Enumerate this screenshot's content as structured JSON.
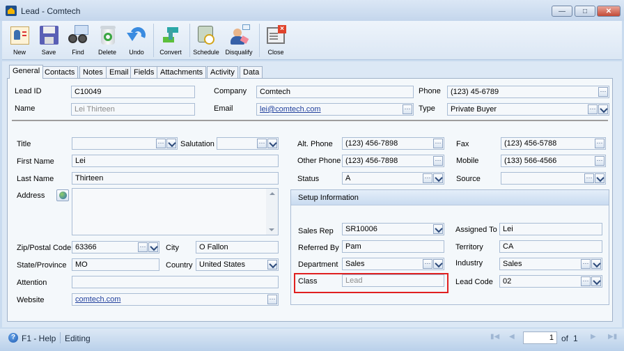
{
  "window": {
    "title": "Lead - Comtech",
    "controls": [
      "minimize",
      "maximize",
      "close"
    ]
  },
  "toolbar": {
    "items": [
      {
        "label": "New",
        "icon": "new-lead-icon"
      },
      {
        "label": "Save",
        "icon": "floppy-disk-icon"
      },
      {
        "label": "Find",
        "icon": "binoculars-icon"
      },
      {
        "label": "Delete",
        "icon": "recycle-bin-icon"
      },
      {
        "label": "Undo",
        "icon": "undo-arrow-icon"
      },
      {
        "label": "Convert",
        "icon": "convert-arrows-icon"
      },
      {
        "label": "Schedule",
        "icon": "schedule-clock-icon"
      },
      {
        "label": "Disqualify",
        "icon": "disqualify-person-icon"
      },
      {
        "label": "Close",
        "icon": "close-window-icon"
      }
    ]
  },
  "tabs": [
    "General",
    "Contacts",
    "Notes",
    "Email",
    "Fields",
    "Attachments",
    "Activity",
    "Data"
  ],
  "active_tab": "General",
  "header": {
    "lead_id": {
      "label": "Lead ID",
      "value": "C10049"
    },
    "name": {
      "label": "Name",
      "value": "Lei Thirteen"
    },
    "company": {
      "label": "Company",
      "value": "Comtech"
    },
    "email": {
      "label": "Email",
      "value": "lei@comtech.com"
    },
    "phone": {
      "label": "Phone",
      "value": "(123) 45-6789"
    },
    "type": {
      "label": "Type",
      "value": "Private Buyer"
    }
  },
  "contact": {
    "title": {
      "label": "Title",
      "value": ""
    },
    "salutation": {
      "label": "Salutation",
      "value": ""
    },
    "first_name": {
      "label": "First Name",
      "value": "Lei"
    },
    "last_name": {
      "label": "Last Name",
      "value": "Thirteen"
    },
    "address": {
      "label": "Address",
      "value": ""
    },
    "zip": {
      "label": "Zip/Postal Code",
      "value": "63366"
    },
    "city": {
      "label": "City",
      "value": "O Fallon"
    },
    "state": {
      "label": "State/Province",
      "value": "MO"
    },
    "country": {
      "label": "Country",
      "value": "United States"
    },
    "attention": {
      "label": "Attention",
      "value": ""
    },
    "website": {
      "label": "Website",
      "value": "comtech.com"
    },
    "alt_phone": {
      "label": "Alt. Phone",
      "value": "(123) 456-7898"
    },
    "other_phone": {
      "label": "Other Phone",
      "value": "(123) 456-7898"
    },
    "status": {
      "label": "Status",
      "value": "A"
    },
    "fax": {
      "label": "Fax",
      "value": "(123) 456-5788"
    },
    "mobile": {
      "label": "Mobile",
      "value": "(133) 566-4566"
    },
    "source": {
      "label": "Source",
      "value": ""
    }
  },
  "setup": {
    "title": "Setup Information",
    "sales_rep": {
      "label": "Sales Rep",
      "value": "SR10006"
    },
    "referred_by": {
      "label": "Referred By",
      "value": "Pam"
    },
    "department": {
      "label": "Department",
      "value": "Sales"
    },
    "class": {
      "label": "Class",
      "value": "Lead"
    },
    "assigned_to": {
      "label": "Assigned To",
      "value": "Lei"
    },
    "territory": {
      "label": "Territory",
      "value": "CA"
    },
    "industry": {
      "label": "Industry",
      "value": "Sales"
    },
    "lead_code": {
      "label": "Lead Code",
      "value": "02"
    }
  },
  "statusbar": {
    "help": "F1 - Help",
    "status": "Editing",
    "page": "1",
    "of_label": "of",
    "total": "1"
  },
  "colors": {
    "highlight": "#e02020",
    "link": "#1f3f9c"
  }
}
